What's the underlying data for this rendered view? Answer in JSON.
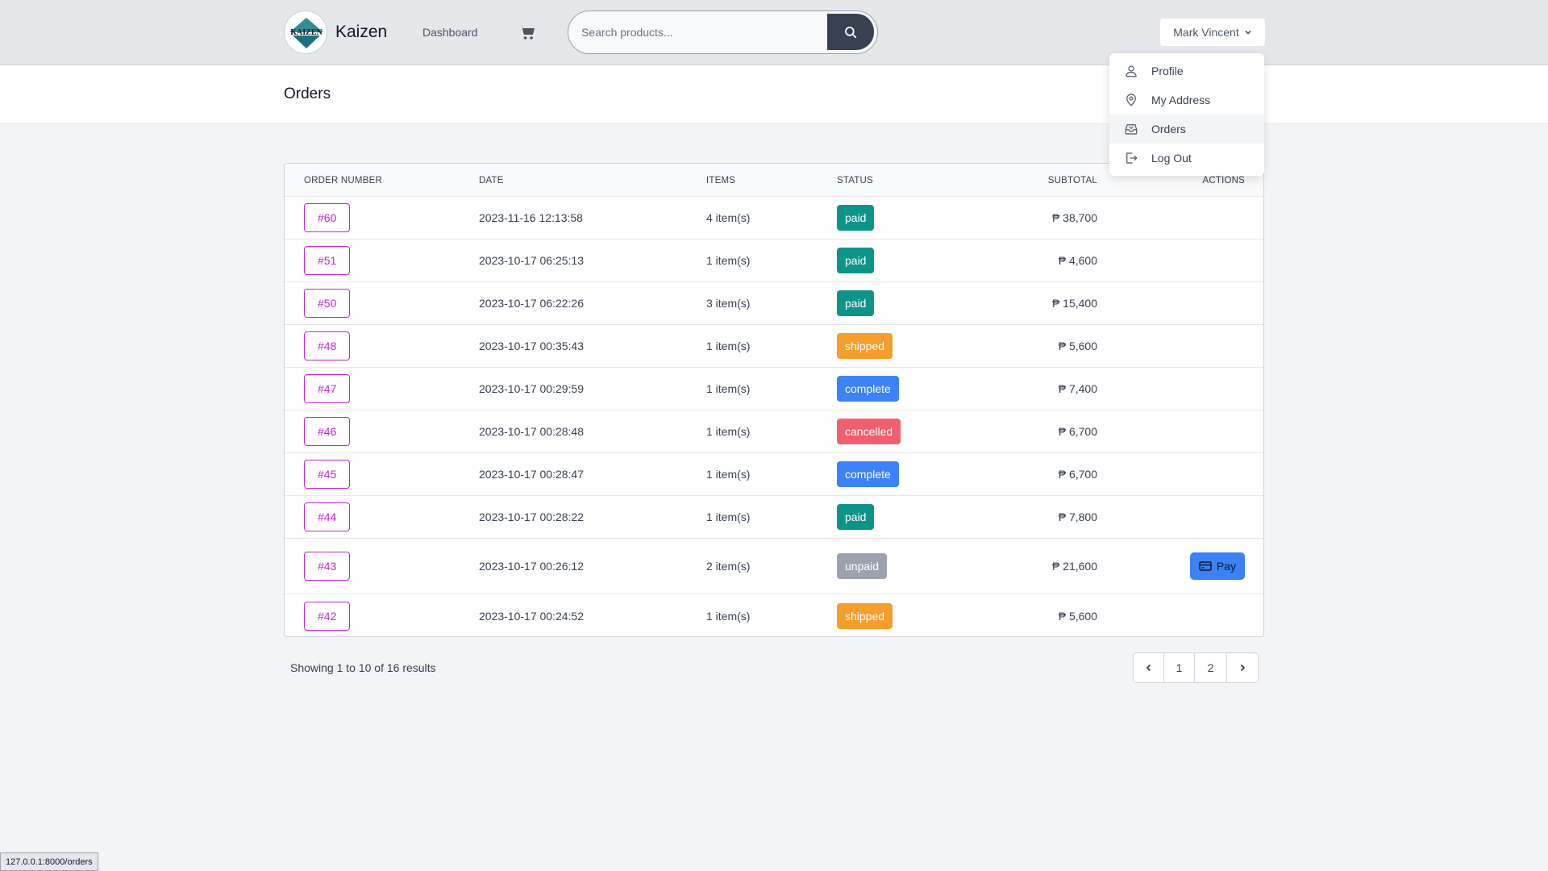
{
  "nav": {
    "brand": "Kaizen",
    "logo_text": "KAIZEN",
    "dashboard_label": "Dashboard",
    "search_placeholder": "Search products...",
    "user_name": "Mark Vincent"
  },
  "dropdown": {
    "items": [
      {
        "label": "Profile",
        "icon": "person-icon"
      },
      {
        "label": "My Address",
        "icon": "location-pin-icon"
      },
      {
        "label": "Orders",
        "icon": "inbox-icon"
      },
      {
        "label": "Log Out",
        "icon": "logout-icon"
      }
    ]
  },
  "page": {
    "title": "Orders"
  },
  "colors": {
    "paid": "#0d9488",
    "shipped": "#f59e2b",
    "complete": "#3b82f6",
    "cancelled": "#f05f6e",
    "unpaid": "#9ca3af",
    "order_link": "#c026d3"
  },
  "table": {
    "headers": {
      "order_number": "ORDER NUMBER",
      "date": "DATE",
      "items": "ITEMS",
      "status": "STATUS",
      "subtotal": "SUBTOTAL",
      "actions": "ACTIONS"
    },
    "rows": [
      {
        "order": "#60",
        "date": "2023-11-16 12:13:58",
        "items": "4 item(s)",
        "status": "paid",
        "subtotal": "₱ 38,700",
        "action": ""
      },
      {
        "order": "#51",
        "date": "2023-10-17 06:25:13",
        "items": "1 item(s)",
        "status": "paid",
        "subtotal": "₱ 4,600",
        "action": ""
      },
      {
        "order": "#50",
        "date": "2023-10-17 06:22:26",
        "items": "3 item(s)",
        "status": "paid",
        "subtotal": "₱ 15,400",
        "action": ""
      },
      {
        "order": "#48",
        "date": "2023-10-17 00:35:43",
        "items": "1 item(s)",
        "status": "shipped",
        "subtotal": "₱ 5,600",
        "action": ""
      },
      {
        "order": "#47",
        "date": "2023-10-17 00:29:59",
        "items": "1 item(s)",
        "status": "complete",
        "subtotal": "₱ 7,400",
        "action": ""
      },
      {
        "order": "#46",
        "date": "2023-10-17 00:28:48",
        "items": "1 item(s)",
        "status": "cancelled",
        "subtotal": "₱ 6,700",
        "action": ""
      },
      {
        "order": "#45",
        "date": "2023-10-17 00:28:47",
        "items": "1 item(s)",
        "status": "complete",
        "subtotal": "₱ 6,700",
        "action": ""
      },
      {
        "order": "#44",
        "date": "2023-10-17 00:28:22",
        "items": "1 item(s)",
        "status": "paid",
        "subtotal": "₱ 7,800",
        "action": ""
      },
      {
        "order": "#43",
        "date": "2023-10-17 00:26:12",
        "items": "2 item(s)",
        "status": "unpaid",
        "subtotal": "₱ 21,600",
        "action": "Pay"
      },
      {
        "order": "#42",
        "date": "2023-10-17 00:24:52",
        "items": "1 item(s)",
        "status": "shipped",
        "subtotal": "₱ 5,600",
        "action": ""
      }
    ]
  },
  "pagination": {
    "showing_text": "Showing 1 to 10 of 16 results",
    "pages": [
      "1",
      "2"
    ],
    "prev_icon": "chevron-left-icon",
    "next_icon": "chevron-right-icon"
  },
  "statusbar": {
    "url": "127.0.0.1:8000/orders"
  }
}
